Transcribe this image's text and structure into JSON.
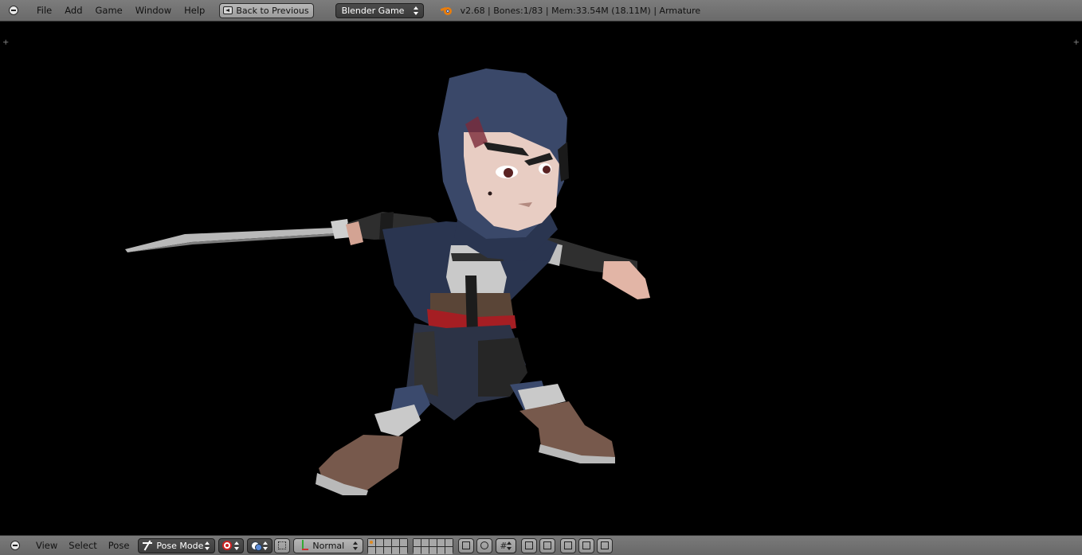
{
  "top_header": {
    "menu": [
      "File",
      "Add",
      "Game",
      "Window",
      "Help"
    ],
    "back_button": "Back to Previous",
    "engine": "Blender Game",
    "stats": "v2.68 | Bones:1/83  | Mem:33.54M (18.11M) | Armature"
  },
  "viewport": {
    "corner_left": "+",
    "corner_right": "+"
  },
  "bottom_header": {
    "menu": [
      "View",
      "Select",
      "Pose"
    ],
    "mode": "Pose Mode",
    "transform_orientation": "Normal"
  }
}
